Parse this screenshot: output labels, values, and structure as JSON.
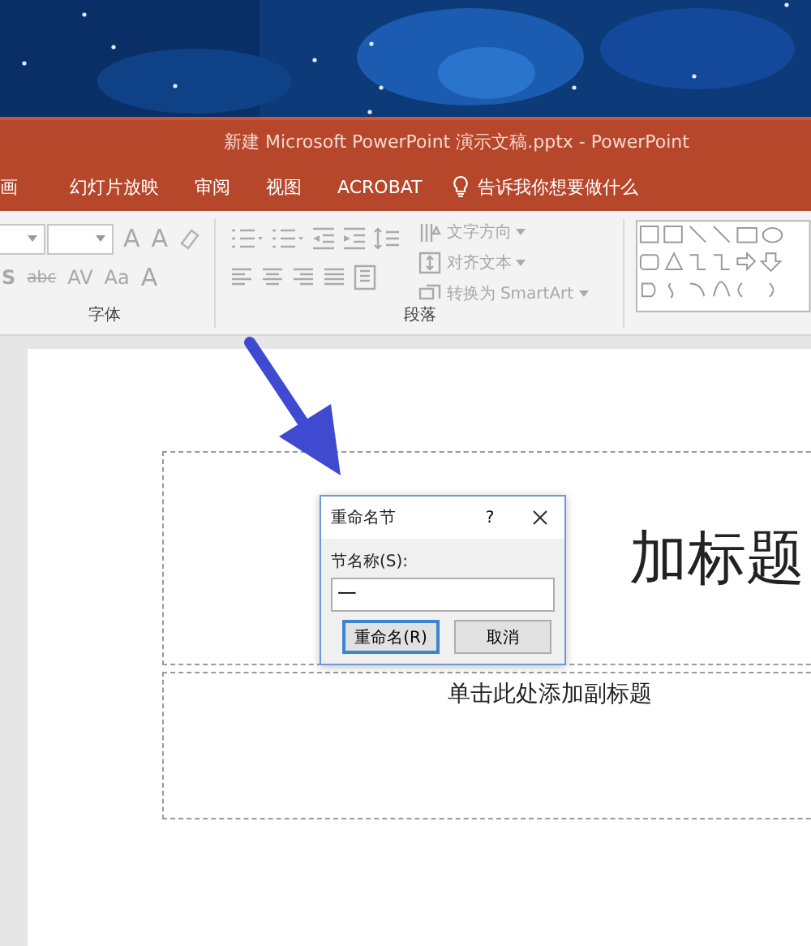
{
  "title_bar": {
    "title": "新建 Microsoft PowerPoint 演示文稿.pptx  -  PowerPoint"
  },
  "tabs": [
    {
      "label": "画",
      "selected": false
    },
    {
      "label": "幻灯片放映",
      "selected": false
    },
    {
      "label": "审阅",
      "selected": false
    },
    {
      "label": "视图",
      "selected": false
    },
    {
      "label": "ACROBAT",
      "selected": false
    }
  ],
  "tell_me": "告诉我你想要做什么",
  "ribbon": {
    "font_group": {
      "label": "字体",
      "row1": [
        "A",
        "A"
      ],
      "row2": [
        "S",
        "abc",
        "AV",
        "Aa",
        "A"
      ]
    },
    "paragraph_group": {
      "label": "段落",
      "commands": [
        "文字方向",
        "对齐文本",
        "转换为 SmartArt"
      ]
    }
  },
  "slide": {
    "title_visible": "加标题",
    "subtitle": "单击此处添加副标题"
  },
  "dialog": {
    "title": "重命名节",
    "help": "?",
    "field_label": "节名称(S):",
    "value": "一",
    "buttons": [
      {
        "label": "重命名(R)",
        "default": true
      },
      {
        "label": "取消",
        "default": false
      }
    ]
  }
}
